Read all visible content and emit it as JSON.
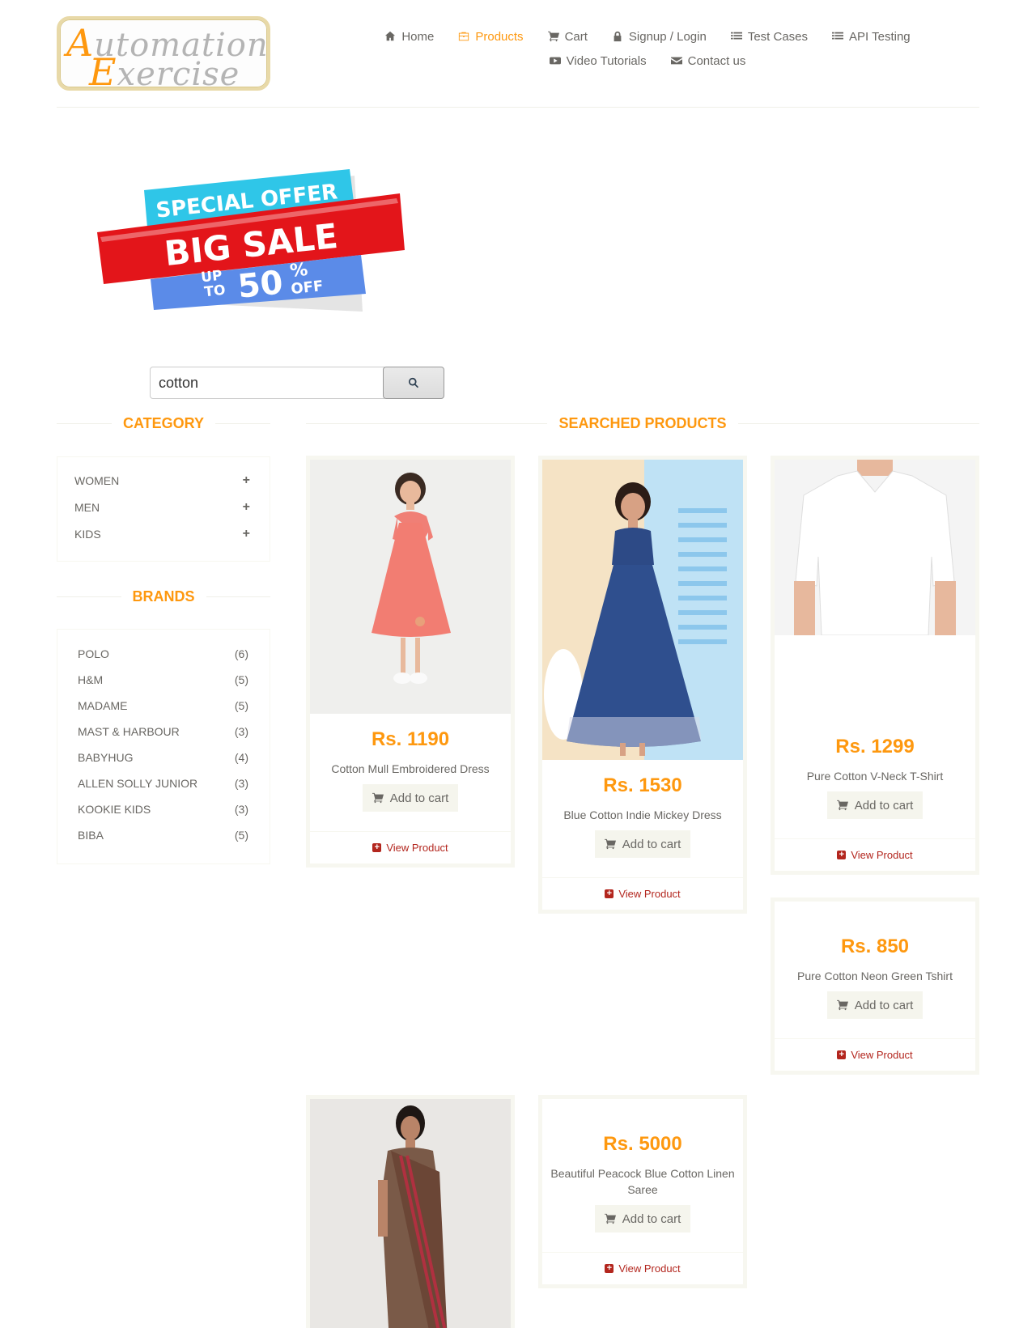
{
  "logo": {
    "line1_cap": "A",
    "line1_rest": "utomation",
    "line2_cap": "E",
    "line2_rest": "xercise"
  },
  "nav": {
    "items": [
      {
        "label": "Home",
        "icon": "home-icon"
      },
      {
        "label": "Products",
        "icon": "briefcase-icon",
        "active": true
      },
      {
        "label": "Cart",
        "icon": "cart-icon"
      },
      {
        "label": "Signup / Login",
        "icon": "lock-icon"
      },
      {
        "label": "Test Cases",
        "icon": "list-icon"
      },
      {
        "label": "API Testing",
        "icon": "list-icon"
      },
      {
        "label": "Video Tutorials",
        "icon": "youtube-icon"
      },
      {
        "label": "Contact us",
        "icon": "envelope-icon"
      }
    ]
  },
  "banner": {
    "top": "SPECIAL OFFER",
    "main": "BIG SALE",
    "up": "UP",
    "to": "TO",
    "pct": "50",
    "sym": "%",
    "off": "OFF"
  },
  "search": {
    "value": "cotton",
    "button_icon": "search-icon"
  },
  "category": {
    "title": "CATEGORY",
    "items": [
      {
        "label": "WOMEN"
      },
      {
        "label": "MEN"
      },
      {
        "label": "KIDS"
      }
    ]
  },
  "brands": {
    "title": "BRANDS",
    "items": [
      {
        "name": "POLO",
        "count": "(6)"
      },
      {
        "name": "H&M",
        "count": "(5)"
      },
      {
        "name": "MADAME",
        "count": "(5)"
      },
      {
        "name": "MAST & HARBOUR",
        "count": "(3)"
      },
      {
        "name": "BABYHUG",
        "count": "(4)"
      },
      {
        "name": "ALLEN SOLLY JUNIOR",
        "count": "(3)"
      },
      {
        "name": "KOOKIE KIDS",
        "count": "(3)"
      },
      {
        "name": "BIBA",
        "count": "(5)"
      }
    ]
  },
  "products": {
    "title": "SEARCHED PRODUCTS",
    "add_label": "Add to cart",
    "view_label": "View Product",
    "items": [
      {
        "price": "Rs. 1190",
        "name": "Cotton Mull Embroidered Dress"
      },
      {
        "price": "Rs. 1530",
        "name": "Blue Cotton Indie Mickey Dress"
      },
      {
        "price": "Rs. 1299",
        "name": "Pure Cotton V-Neck T-Shirt"
      },
      {
        "price": "Rs. 850",
        "name": "Pure Cotton Neon Green Tshirt"
      },
      {
        "price": "Rs. 5000",
        "name": "Beautiful Peacock Blue Cotton Linen Saree"
      }
    ]
  },
  "colors": {
    "accent": "#FE980F",
    "text": "#696763",
    "link": "#B3261E",
    "button_bg": "#F5F5ED"
  }
}
